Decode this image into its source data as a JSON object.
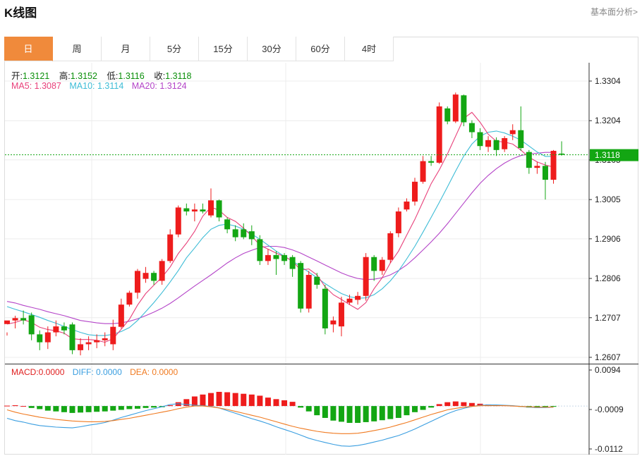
{
  "header": {
    "title": "K线图",
    "link": "基本面分析>"
  },
  "tabs": [
    "日",
    "周",
    "月",
    "5分",
    "15分",
    "30分",
    "60分",
    "4时"
  ],
  "active_tab": 0,
  "ohlc": {
    "open_label": "开:",
    "open": "1.3121",
    "high_label": "高:",
    "high": "1.3152",
    "low_label": "低:",
    "low": "1.3116",
    "close_label": "收:",
    "close": "1.3118"
  },
  "ma_legend": {
    "ma5": "MA5: 1.3087",
    "ma10": "MA10: 1.3114",
    "ma20": "MA20: 1.3124",
    "colors": {
      "ma5": "#e8407a",
      "ma10": "#3dbcd6",
      "ma20": "#b444c8"
    }
  },
  "macd_legend": {
    "macd": "MACD:0.0000",
    "diff": "DIFF: 0.0000",
    "dea": "DEA: 0.0000",
    "colors": {
      "macd": "#e02020",
      "diff": "#3a9ee0",
      "dea": "#f07a20"
    }
  },
  "colors": {
    "up": "#ee1c1c",
    "down": "#13a613",
    "accent": "#f08a3b"
  },
  "chart_data": [
    {
      "type": "candlestick",
      "y_ticks": [
        "1.3304",
        "1.3204",
        "1.3105",
        "1.3005",
        "1.2906",
        "1.2806",
        "1.2707",
        "1.2607"
      ],
      "ylim": [
        1.2607,
        1.3304
      ],
      "current_price": "1.3118",
      "candles": [
        [
          1.2691,
          1.27,
          1.267,
          1.2662
        ],
        [
          1.27,
          1.2706,
          1.2712,
          1.268
        ],
        [
          1.2706,
          1.27,
          1.2725,
          1.269
        ],
        [
          1.2713,
          1.2665,
          1.272,
          1.265
        ],
        [
          1.2665,
          1.2645,
          1.2675,
          1.2625
        ],
        [
          1.2645,
          1.267,
          1.2685,
          1.2628
        ],
        [
          1.267,
          1.2685,
          1.27,
          1.266
        ],
        [
          1.2685,
          1.2675,
          1.2695,
          1.2665
        ],
        [
          1.269,
          1.2625,
          1.2695,
          1.2615
        ],
        [
          1.2625,
          1.264,
          1.2655,
          1.2612
        ],
        [
          1.264,
          1.2645,
          1.266,
          1.2625
        ],
        [
          1.2645,
          1.265,
          1.2665,
          1.263
        ],
        [
          1.265,
          1.2655,
          1.267,
          1.2635
        ],
        [
          1.264,
          1.2684,
          1.2702,
          1.2625
        ],
        [
          1.2684,
          1.274,
          1.2755,
          1.268
        ],
        [
          1.274,
          1.277,
          1.2775,
          1.2735
        ],
        [
          1.277,
          1.2825,
          1.283,
          1.2755
        ],
        [
          1.2805,
          1.282,
          1.2835,
          1.2795
        ],
        [
          1.282,
          1.28,
          1.2825,
          1.279
        ],
        [
          1.28,
          1.285,
          1.2855,
          1.279
        ],
        [
          1.285,
          1.2917,
          1.293,
          1.2845
        ],
        [
          1.2917,
          1.2985,
          1.299,
          1.291
        ],
        [
          1.2983,
          1.2975,
          1.2995,
          1.2965
        ],
        [
          1.2975,
          1.298,
          1.2995,
          1.295
        ],
        [
          1.298,
          1.2975,
          1.2995,
          1.297
        ],
        [
          1.2965,
          1.3003,
          1.3033,
          1.296
        ],
        [
          1.3003,
          1.296,
          1.3005,
          1.295
        ],
        [
          1.2955,
          1.293,
          1.296,
          1.292
        ],
        [
          1.293,
          1.291,
          1.294,
          1.29
        ],
        [
          1.293,
          1.291,
          1.2945,
          1.2905
        ],
        [
          1.2925,
          1.2905,
          1.294,
          1.289
        ],
        [
          1.2905,
          1.285,
          1.2915,
          1.284
        ],
        [
          1.285,
          1.2865,
          1.288,
          1.284
        ],
        [
          1.2865,
          1.2855,
          1.2875,
          1.2815
        ],
        [
          1.2865,
          1.285,
          1.287,
          1.284
        ],
        [
          1.286,
          1.283,
          1.2865,
          1.281
        ],
        [
          1.2845,
          1.273,
          1.285,
          1.272
        ],
        [
          1.273,
          1.2815,
          1.2825,
          1.272
        ],
        [
          1.281,
          1.279,
          1.282,
          1.278
        ],
        [
          1.278,
          1.268,
          1.279,
          1.2665
        ],
        [
          1.269,
          1.27,
          1.271,
          1.267
        ],
        [
          1.2685,
          1.2745,
          1.276,
          1.266
        ],
        [
          1.2745,
          1.2755,
          1.2765,
          1.274
        ],
        [
          1.2752,
          1.2762,
          1.2772,
          1.274
        ],
        [
          1.2762,
          1.286,
          1.287,
          1.275
        ],
        [
          1.286,
          1.2825,
          1.2865,
          1.28
        ],
        [
          1.2825,
          1.2853,
          1.286,
          1.2815
        ],
        [
          1.2853,
          1.292,
          1.2925,
          1.2845
        ],
        [
          1.292,
          1.2975,
          1.2985,
          1.291
        ],
        [
          1.298,
          1.3,
          1.3008,
          1.2975
        ],
        [
          1.3,
          1.305,
          1.306,
          1.299
        ],
        [
          1.305,
          1.3102,
          1.3115,
          1.3045
        ],
        [
          1.3102,
          1.3098,
          1.3115,
          1.309
        ],
        [
          1.3098,
          1.324,
          1.325,
          1.3095
        ],
        [
          1.3235,
          1.3202,
          1.324,
          1.3195
        ],
        [
          1.3202,
          1.327,
          1.3275,
          1.3198
        ],
        [
          1.3268,
          1.32,
          1.327,
          1.319
        ],
        [
          1.3198,
          1.3175,
          1.3205,
          1.316
        ],
        [
          1.3175,
          1.314,
          1.3185,
          1.313
        ],
        [
          1.3138,
          1.3155,
          1.3165,
          1.3125
        ],
        [
          1.3155,
          1.313,
          1.3162,
          1.3115
        ],
        [
          1.3132,
          1.316,
          1.3165,
          1.3125
        ],
        [
          1.317,
          1.318,
          1.3195,
          1.3155
        ],
        [
          1.318,
          1.3135,
          1.324,
          1.3128
        ],
        [
          1.3125,
          1.3085,
          1.313,
          1.307
        ],
        [
          1.3085,
          1.309,
          1.31,
          1.307
        ],
        [
          1.309,
          1.3055,
          1.31,
          1.3005
        ],
        [
          1.3055,
          1.3128,
          1.313,
          1.3045
        ],
        [
          1.3121,
          1.3118,
          1.3152,
          1.3116
        ]
      ],
      "ma5": [
        1.2691,
        1.2695,
        1.2702,
        1.2695,
        1.2683,
        1.2677,
        1.2674,
        1.2668,
        1.2654,
        1.2652,
        1.2652,
        1.265,
        1.2645,
        1.2654,
        1.2678,
        1.2703,
        1.2739,
        1.2768,
        1.2789,
        1.2809,
        1.2835,
        1.2869,
        1.2895,
        1.2925,
        1.2963,
        1.2986,
        1.2978,
        1.296,
        1.295,
        1.2933,
        1.2913,
        1.289,
        1.288,
        1.287,
        1.2861,
        1.285,
        1.2827,
        1.283,
        1.2815,
        1.2785,
        1.2765,
        1.2753,
        1.274,
        1.2728,
        1.2745,
        1.278,
        1.2808,
        1.2845,
        1.2875,
        1.2915,
        1.2955,
        1.3,
        1.3045,
        1.308,
        1.312,
        1.3165,
        1.321,
        1.3225,
        1.32,
        1.317,
        1.3152,
        1.315,
        1.3145,
        1.313,
        1.3112,
        1.31,
        1.3092,
        1.3087
      ],
      "ma10": [
        1.2735,
        1.2728,
        1.2722,
        1.2715,
        1.2708,
        1.27,
        1.2693,
        1.2685,
        1.2677,
        1.267,
        1.2664,
        1.2662,
        1.2662,
        1.2665,
        1.2672,
        1.2682,
        1.27,
        1.2722,
        1.2745,
        1.277,
        1.2797,
        1.2826,
        1.2858,
        1.2883,
        1.2909,
        1.293,
        1.294,
        1.2943,
        1.2938,
        1.293,
        1.2918,
        1.2905,
        1.289,
        1.2875,
        1.2862,
        1.285,
        1.2836,
        1.2822,
        1.2808,
        1.2793,
        1.278,
        1.2768,
        1.276,
        1.2756,
        1.2757,
        1.2765,
        1.278,
        1.28,
        1.2825,
        1.2855,
        1.2887,
        1.2923,
        1.296,
        1.2998,
        1.3037,
        1.3077,
        1.3115,
        1.3145,
        1.3165,
        1.3175,
        1.3178,
        1.3173,
        1.3165,
        1.3155,
        1.314,
        1.3125,
        1.3114,
        1.3114
      ],
      "ma20": [
        1.2748,
        1.2744,
        1.2738,
        1.2733,
        1.2728,
        1.2722,
        1.2717,
        1.2712,
        1.2706,
        1.27,
        1.2697,
        1.2694,
        1.2692,
        1.2692,
        1.2694,
        1.2698,
        1.2704,
        1.2712,
        1.2721,
        1.2731,
        1.2743,
        1.2757,
        1.2772,
        1.2787,
        1.2801,
        1.2815,
        1.283,
        1.2845,
        1.2858,
        1.2869,
        1.2877,
        1.2884,
        1.2887,
        1.2887,
        1.2884,
        1.2878,
        1.287,
        1.286,
        1.285,
        1.284,
        1.283,
        1.282,
        1.2812,
        1.2806,
        1.2803,
        1.2804,
        1.2808,
        1.2815,
        1.2826,
        1.284,
        1.2858,
        1.2878,
        1.2898,
        1.292,
        1.2944,
        1.297,
        1.2996,
        1.3022,
        1.3046,
        1.3066,
        1.3083,
        1.3097,
        1.3108,
        1.3116,
        1.312,
        1.3122,
        1.3124,
        1.3124
      ]
    },
    {
      "type": "macd",
      "y_ticks": [
        "0.0094",
        "-0.0009",
        "-0.0112"
      ],
      "ylim": [
        -0.0112,
        0.0094
      ],
      "histogram": [
        0.0001,
        0.0002,
        0.0,
        -0.0005,
        -0.0008,
        -0.0012,
        -0.0014,
        -0.0016,
        -0.0018,
        -0.0017,
        -0.0016,
        -0.0015,
        -0.0014,
        -0.0012,
        -0.001,
        -0.0008,
        -0.0007,
        -0.0005,
        -0.0004,
        -0.0003,
        0.0002,
        0.001,
        0.0018,
        0.0025,
        0.003,
        0.0034,
        0.0037,
        0.0036,
        0.0034,
        0.0032,
        0.003,
        0.0027,
        0.0022,
        0.0018,
        0.0015,
        0.0011,
        -0.0004,
        -0.0014,
        -0.0024,
        -0.0031,
        -0.0038,
        -0.0041,
        -0.0044,
        -0.0044,
        -0.0042,
        -0.004,
        -0.0037,
        -0.0034,
        -0.0031,
        -0.0024,
        -0.0016,
        -0.001,
        -0.0004,
        0.0005,
        0.001,
        0.0012,
        0.001,
        0.0008,
        0.0006,
        0.0004,
        0.0003,
        0.0002,
        0.0001,
        -0.0002,
        -0.0004,
        -0.0005,
        -0.0004,
        -0.0002
      ],
      "diff": [
        -0.0032,
        -0.0038,
        -0.0042,
        -0.0047,
        -0.0051,
        -0.0053,
        -0.0055,
        -0.0056,
        -0.0057,
        -0.0054,
        -0.005,
        -0.0047,
        -0.0043,
        -0.0037,
        -0.003,
        -0.0024,
        -0.0018,
        -0.0012,
        -0.0007,
        -0.0002,
        0.0004,
        0.0006,
        0.0004,
        0.0002,
        0.0001,
        -0.0001,
        -0.0005,
        -0.0012,
        -0.0019,
        -0.0026,
        -0.0033,
        -0.0039,
        -0.0046,
        -0.0054,
        -0.0061,
        -0.0068,
        -0.0076,
        -0.0084,
        -0.009,
        -0.0095,
        -0.01,
        -0.0104,
        -0.0105,
        -0.0103,
        -0.0099,
        -0.0094,
        -0.0089,
        -0.0083,
        -0.0077,
        -0.0069,
        -0.006,
        -0.005,
        -0.004,
        -0.003,
        -0.002,
        -0.0012,
        -0.0006,
        -0.0001,
        0.0002,
        0.0003,
        0.0003,
        0.0002,
        0.0001,
        -0.0001,
        -0.0003,
        -0.0004,
        -0.0004,
        -0.0003
      ],
      "dea": [
        -0.001,
        -0.0016,
        -0.0021,
        -0.0025,
        -0.0029,
        -0.0032,
        -0.0035,
        -0.0037,
        -0.0039,
        -0.004,
        -0.0041,
        -0.0041,
        -0.004,
        -0.0038,
        -0.0035,
        -0.0032,
        -0.0028,
        -0.0024,
        -0.002,
        -0.0016,
        -0.0012,
        -0.0007,
        -0.0003,
        0.0,
        0.0,
        -0.0002,
        -0.0005,
        -0.0009,
        -0.0014,
        -0.0019,
        -0.0024,
        -0.0029,
        -0.0035,
        -0.0041,
        -0.0047,
        -0.0053,
        -0.0058,
        -0.0062,
        -0.0066,
        -0.0069,
        -0.0071,
        -0.0072,
        -0.0072,
        -0.0071,
        -0.0068,
        -0.0064,
        -0.006,
        -0.0055,
        -0.0049,
        -0.0043,
        -0.0036,
        -0.0029,
        -0.0022,
        -0.0016,
        -0.001,
        -0.0006,
        -0.0003,
        -0.0001,
        0.0001,
        0.0001,
        0.0001,
        0.0001,
        0.0,
        -0.0001,
        -0.0002,
        -0.0003,
        -0.0003,
        -0.0003
      ]
    }
  ]
}
